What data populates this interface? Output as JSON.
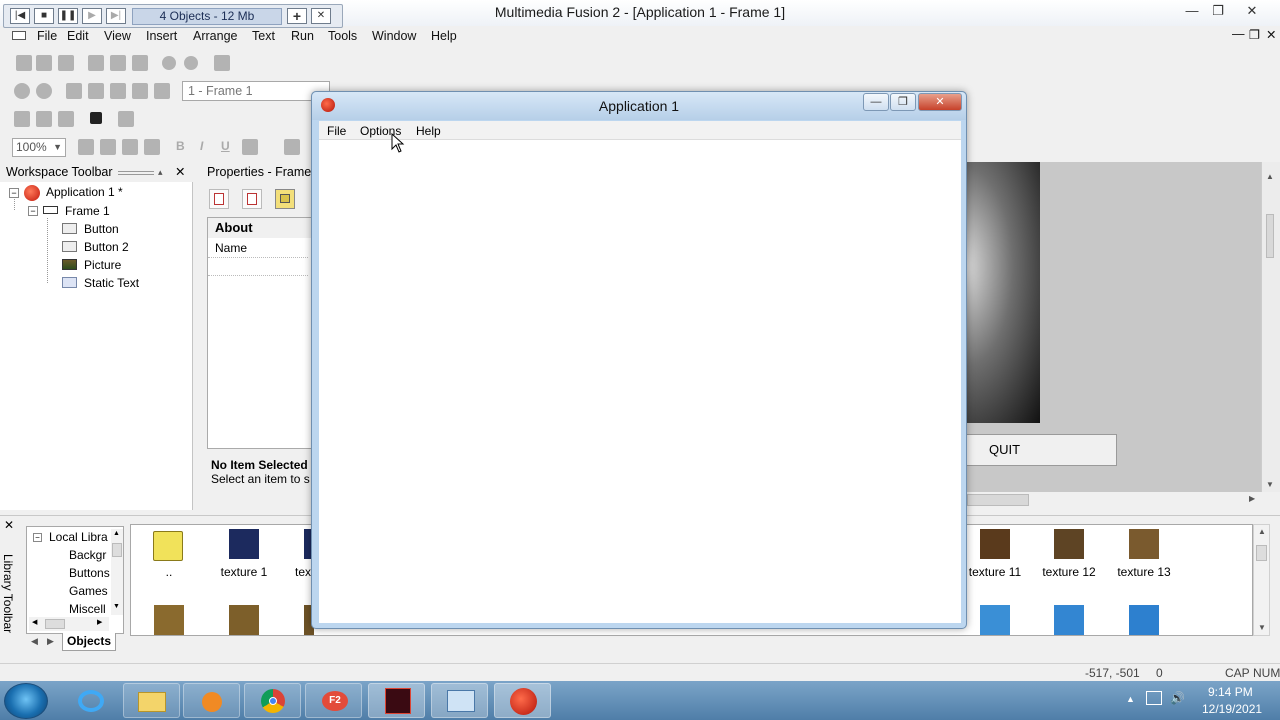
{
  "window": {
    "title": "Multimedia Fusion 2 - [Application 1 - Frame 1]",
    "min_glyph": "—",
    "restore_glyph": "❐",
    "close_glyph": "✕",
    "inner_min_glyph": "—",
    "inner_restore_glyph": "❐",
    "inner_close_glyph": "✕"
  },
  "navigator": {
    "info": "4 Objects - 12 Mb",
    "plus_glyph": "+",
    "close_glyph": "✕"
  },
  "menubar": {
    "items": [
      "File",
      "Edit",
      "View",
      "Insert",
      "Arrange",
      "Text",
      "Run",
      "Tools",
      "Window",
      "Help"
    ]
  },
  "toolbar": {
    "frame_selector": "1 - Frame 1",
    "zoom": "100%",
    "bold": "B",
    "italic": "I",
    "underline": "U"
  },
  "workspace": {
    "title": "Workspace Toolbar",
    "close_glyph": "✕",
    "tree": {
      "application": "Application 1 *",
      "frame": "Frame 1",
      "objects": [
        "Button",
        "Button 2",
        "Picture",
        "Static Text"
      ]
    }
  },
  "properties": {
    "title": "Properties - Frame",
    "section": "About",
    "field_name": "Name",
    "info_title": "No Item Selected",
    "info_text": "Select an item to s"
  },
  "editor": {
    "quit_label": "QUIT"
  },
  "library": {
    "vertical_label": "Library Toolbar",
    "close_glyph": "✕",
    "tree": [
      "Local Libra",
      "Backgr",
      "Buttons",
      "Games",
      "Miscell"
    ],
    "tab": "Objects",
    "items_row1": [
      "..",
      "texture 1",
      "tex",
      "texture 11",
      "texture 12",
      "texture 13"
    ]
  },
  "status": {
    "coords": "-517, -501",
    "value": "0",
    "cap": "CAP",
    "num": "NUM"
  },
  "app_window": {
    "title": "Application 1",
    "menu": [
      "File",
      "Options",
      "Help"
    ]
  },
  "taskbar": {
    "time": "9:14 PM",
    "date": "12/19/2021"
  },
  "colors": {
    "accent": "#4f7ea8",
    "dialog_frame": "#bcd6ef"
  }
}
